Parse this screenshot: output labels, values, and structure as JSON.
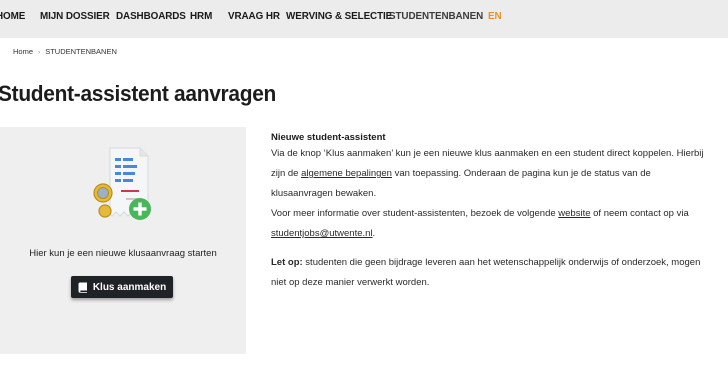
{
  "nav": {
    "items": [
      {
        "label": "HOME"
      },
      {
        "label": "MIJN DOSSIER"
      },
      {
        "label": "DASHBOARDS"
      },
      {
        "label": "HRM"
      },
      {
        "label": "VRAAG HR"
      },
      {
        "label": "WERVING & SELECTIE"
      },
      {
        "label": "STUDENTENBANEN"
      }
    ],
    "lang": "EN",
    "accent_color": "#e8912b"
  },
  "breadcrumb": {
    "home": "Home",
    "separator": "›",
    "current": "STUDENTENBANEN"
  },
  "page": {
    "title": "Student-assistent aanvragen"
  },
  "panel": {
    "illustration_icon": "document-with-coins-and-plus-icon",
    "text": "Hier kun je een nieuwe klusaanvraag starten",
    "button_label": "Klus aanmaken",
    "button_icon": "book-icon"
  },
  "content": {
    "heading": "Nieuwe student-assistent",
    "p1_before_link": "Via de knop ‘Klus aanmaken’ kun je een nieuwe klus aanmaken en een student direct koppelen. Hierbij zijn de ",
    "p1_link": "algemene bepalingen",
    "p1_after_link": " van toepassing. Onderaan de pagina kun je de status van de klusaanvragen bewaken.",
    "p2_before_link": "Voor meer informatie over student-assistenten, bezoek de volgende ",
    "p2_link": "website",
    "p2_middle": " of neem contact op via ",
    "p2_email": "studentjobs@utwente.nl",
    "p2_end": ".",
    "warn_label": "Let op:",
    "warn_text": " studenten die geen bijdrage leveren aan het wetenschappelijk onderwijs of onderzoek, mogen niet op deze manier verwerkt worden."
  }
}
